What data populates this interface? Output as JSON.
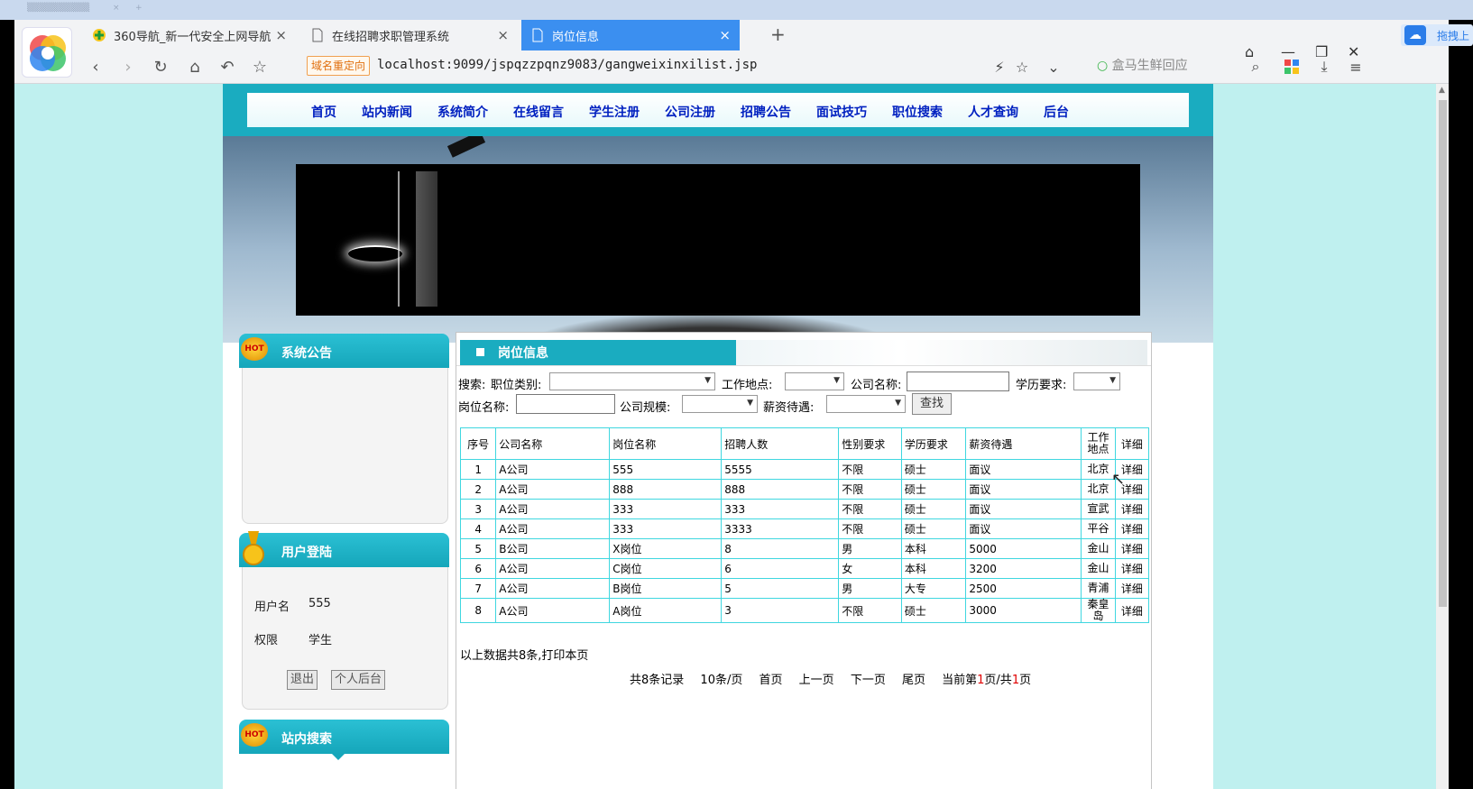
{
  "browser": {
    "tabs": [
      {
        "label": "360导航_新一代安全上网导航",
        "active": false
      },
      {
        "label": "在线招聘求职管理系统",
        "active": false
      },
      {
        "label": "岗位信息",
        "active": true
      }
    ],
    "redirect_badge": "域名重定向",
    "url": "localhost:9099/jspqzzpqnz9083/gangweixinxilist.jsp",
    "search_placeholder": "盒马生鲜回应",
    "cloud_label": "拖拽上"
  },
  "site": {
    "nav": [
      "首页",
      "站内新闻",
      "系统简介",
      "在线留言",
      "学生注册",
      "公司注册",
      "招聘公告",
      "面试技巧",
      "职位搜索",
      "人才查询",
      "后台"
    ],
    "hot_badge": "HOT",
    "sidebar": {
      "notice_title": "系统公告",
      "login_title": "用户登陆",
      "user_label": "用户名",
      "user_value": "555",
      "role_label": "权限",
      "role_value": "学生",
      "logout_btn": "退出",
      "backend_btn": "个人后台",
      "search_title": "站内搜索"
    },
    "main": {
      "title": "岗位信息",
      "filters": {
        "search_prefix": "搜索:",
        "category_label": "职位类别:",
        "location_label": "工作地点:",
        "company_label": "公司名称:",
        "education_label": "学历要求:",
        "job_label": "岗位名称:",
        "size_label": "公司规模:",
        "salary_label": "薪资待遇:",
        "find_btn": "查找"
      },
      "table": {
        "headers": [
          "序号",
          "公司名称",
          "岗位名称",
          "招聘人数",
          "性别要求",
          "学历要求",
          "薪资待遇",
          "工作地点",
          "详细"
        ],
        "rows": [
          [
            "1",
            "A公司",
            "555",
            "5555",
            "不限",
            "硕士",
            "面议",
            "北京",
            "详细"
          ],
          [
            "2",
            "A公司",
            "888",
            "888",
            "不限",
            "硕士",
            "面议",
            "北京",
            "详细"
          ],
          [
            "3",
            "A公司",
            "333",
            "333",
            "不限",
            "硕士",
            "面议",
            "宣武",
            "详细"
          ],
          [
            "4",
            "A公司",
            "333",
            "3333",
            "不限",
            "硕士",
            "面议",
            "平谷",
            "详细"
          ],
          [
            "5",
            "B公司",
            "X岗位",
            "8",
            "男",
            "本科",
            "5000",
            "金山",
            "详细"
          ],
          [
            "6",
            "A公司",
            "C岗位",
            "6",
            "女",
            "本科",
            "3200",
            "金山",
            "详细"
          ],
          [
            "7",
            "A公司",
            "B岗位",
            "5",
            "男",
            "大专",
            "2500",
            "青浦",
            "详细"
          ],
          [
            "8",
            "A公司",
            "A岗位",
            "3",
            "不限",
            "硕士",
            "3000",
            "秦皇岛",
            "详细"
          ]
        ]
      },
      "summary": "以上数据共8条,打印本页",
      "pager": {
        "total": "共8条记录",
        "per_page": "10条/页",
        "first": "首页",
        "prev": "上一页",
        "next": "下一页",
        "last": "尾页",
        "current_prefix": "当前第",
        "current_page": "1",
        "current_mid": "页/共",
        "total_pages": "1",
        "current_suffix": "页"
      }
    }
  },
  "colors": {
    "accent": "#1aacc0",
    "nav_text": "#0020c0",
    "page_bg": "#bff0ef",
    "table_border": "#3fd7e0",
    "active_tab": "#3b8ff0"
  }
}
